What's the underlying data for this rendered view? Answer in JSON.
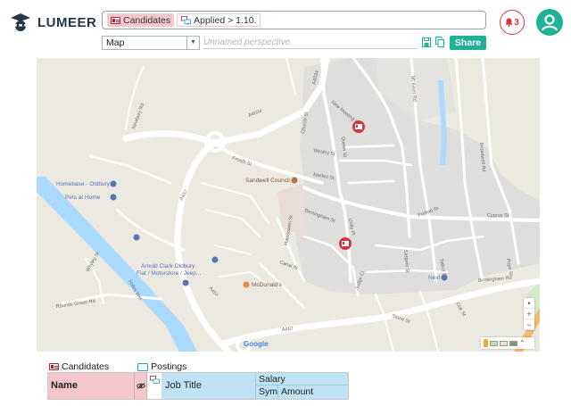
{
  "app": {
    "brand": "LUMEER"
  },
  "search": {
    "chips": [
      {
        "label": "Candidates",
        "icon": "id-card-icon"
      },
      {
        "label": "Applied > 1.10.",
        "icon": "card-monitor-icon"
      }
    ]
  },
  "notifications": {
    "count": "3"
  },
  "perspective": {
    "type": "Map",
    "name_placeholder": "Unnamed perspective",
    "share_label": "Share"
  },
  "map": {
    "poi": {
      "homebase": "Homebase - Oldbury",
      "pets": "Pets at Home",
      "sandwell": "Sandwell Council",
      "mcdonalds": "McDonald's",
      "next": "Next",
      "arnold1": "Arnold Clark Oldbury",
      "arnold2": "Fiat / Motorstore / Jeep..."
    },
    "roads": {
      "a4034": "A4034",
      "church": "Church St",
      "newmeeting": "New Meeting St",
      "mtkeen": "Mt Keen Rd",
      "broadwell": "Broadwell Rd",
      "newbury": "Newbury Rd",
      "freeth": "Freeth St",
      "wesley": "Wesley St",
      "queen": "Queen St",
      "market": "Market St",
      "a457a": "A457",
      "a457b": "A457",
      "a457c": "A457",
      "birmingham1": "Birmingham St",
      "birmingham2": "Birmingham Rd",
      "unity": "Unity Pl",
      "halesowen": "Halesowen St",
      "canal": "Canal St",
      "judge": "Judge Cl",
      "sargent": "Sargent St",
      "portold": "Portold St",
      "cyprus": "Cyprus St",
      "rounds": "Rounds Green Rd",
      "haleswell": "Hales Wel",
      "whyley": "Whyley St",
      "stone": "Stone St",
      "oak": "Oak St",
      "talbot": "Talbot St",
      "pope": "Pope St"
    },
    "attribution": "Google"
  },
  "collections": [
    {
      "name": "Candidates",
      "icon": "id-card-icon"
    },
    {
      "name": "Postings",
      "icon": "monitor-icon"
    }
  ],
  "table": {
    "name_header": "Name",
    "job_title_header": "Job Title",
    "salary_header": "Salary",
    "sym_header": "Sym",
    "amount_header": "Amount"
  },
  "colors": {
    "accent": "#20b296",
    "candidates": "#f3c7cc",
    "postings": "#bfe2f4",
    "alert": "#d8343f"
  }
}
